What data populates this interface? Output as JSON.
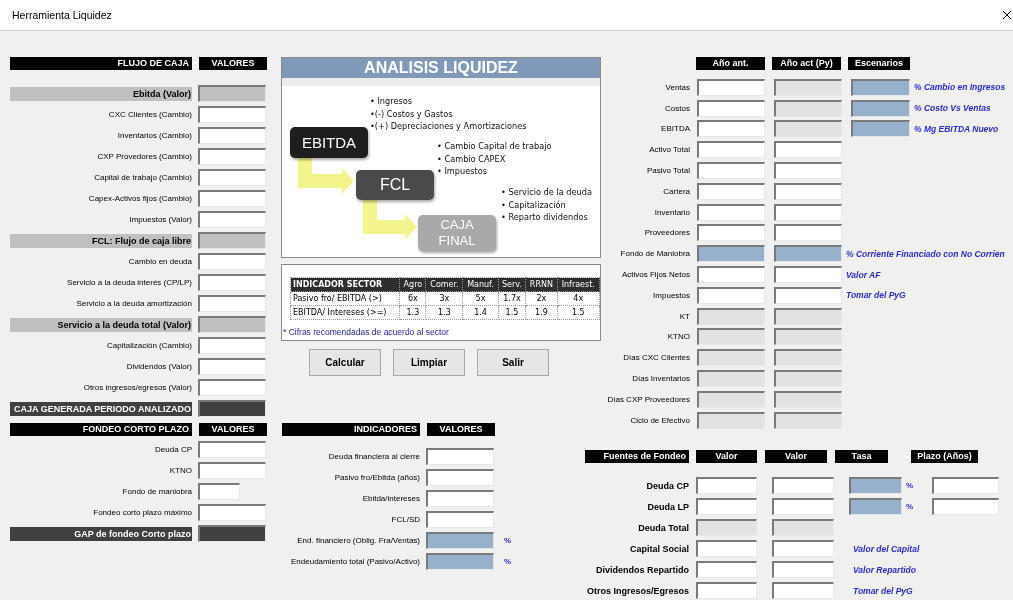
{
  "window": {
    "title": "Herramienta Liquidez"
  },
  "cash_flow": {
    "header": "FLUJO DE CAJA",
    "value_header": "VALORES",
    "rows": [
      {
        "label": "Ebitda (Valor)",
        "kind": "subtotal",
        "field": {
          "kind": "mid"
        }
      },
      {
        "label": "CXC Clientes (Cambio)",
        "kind": "item",
        "field": {
          "kind": "white"
        }
      },
      {
        "label": "Inventarios (Cambio)",
        "kind": "item",
        "field": {
          "kind": "white"
        }
      },
      {
        "label": "CXP Provedores (Cambio)",
        "kind": "item",
        "field": {
          "kind": "white"
        }
      },
      {
        "label": "Capital de trabajo (Cambio)",
        "kind": "item",
        "field": {
          "kind": "white"
        }
      },
      {
        "label": "Capex-Activos fijos (Cambio)",
        "kind": "item",
        "field": {
          "kind": "white"
        }
      },
      {
        "label": "Impuestos (Valor)",
        "kind": "item",
        "field": {
          "kind": "white"
        }
      },
      {
        "label": "FCL: Flujo de caja libre",
        "kind": "subtotal",
        "field": {
          "kind": "mid"
        }
      },
      {
        "label": "Cambio en deuda",
        "kind": "item",
        "field": {
          "kind": "white"
        }
      },
      {
        "label": "Servicio a la deuda interés (CP/LP)",
        "kind": "item",
        "field": {
          "kind": "white"
        }
      },
      {
        "label": "Servicio a la deuda amortización",
        "kind": "item",
        "field": {
          "kind": "white"
        }
      },
      {
        "label": "Servicio a la deuda total (Valor)",
        "kind": "subtotal",
        "field": {
          "kind": "mid"
        }
      },
      {
        "label": "Capitalización (Cambio)",
        "kind": "item",
        "field": {
          "kind": "white"
        }
      },
      {
        "label": "Dividendos (Valor)",
        "kind": "item",
        "field": {
          "kind": "white"
        }
      },
      {
        "label": "Otros ingresos/egresos (Valor)",
        "kind": "item",
        "field": {
          "kind": "white"
        }
      },
      {
        "label": "CAJA GENERADA PERIODO ANALIZADO",
        "kind": "total",
        "field": {
          "kind": "dark"
        }
      }
    ]
  },
  "diagram": {
    "title": "ANALISIS LIQUIDEZ",
    "stages": [
      {
        "label": "EBITDA",
        "kind": "first",
        "bullets": [
          "• Ingresos",
          "•(-) Costos y Gastos",
          "•(+) Depreciaciones y Amortizaciones"
        ]
      },
      {
        "label": "FCL",
        "kind": "second",
        "bullets": [
          "• Cambio Capital de trabajo",
          "• Cambio CAPEX",
          "• Impuestos"
        ]
      },
      {
        "label": "CAJA FINAL",
        "kind": "third",
        "bullets": [
          "• Servicio de la deuda",
          "• Capitalización",
          "• Reparto dividendos"
        ]
      }
    ]
  },
  "sector_table": {
    "columns": [
      "INDICADOR SECTOR",
      "Agro",
      "Comer.",
      "Manuf.",
      "Serv.",
      "RRNN",
      "Infraest."
    ],
    "rows": [
      [
        "Pasivo fro/ EBITDA (>)",
        "6x",
        "3x",
        "5x",
        "1.7x",
        "2x",
        "4x"
      ],
      [
        "EBITDA/ Intereses (>=)",
        "1.3",
        "1.3",
        "1.4",
        "1.5",
        "1.9",
        "1.5"
      ]
    ],
    "footnote": "* Cifras recomendadas de acuerdo al sector"
  },
  "buttons": [
    "Calcular",
    "Limpiar",
    "Salir"
  ],
  "scenario": {
    "headers": [
      "Año ant.",
      "Año act (Py)",
      "Escenarios"
    ],
    "rows": [
      {
        "label": "Ventas",
        "fields": [
          {
            "kind": "white"
          },
          {
            "kind": "gray"
          },
          {
            "kind": "blue"
          }
        ],
        "note": "% Cambio en Ingresos"
      },
      {
        "label": "Costos",
        "fields": [
          {
            "kind": "white"
          },
          {
            "kind": "gray"
          },
          {
            "kind": "blue"
          }
        ],
        "note": "% Costo Vs Ventas"
      },
      {
        "label": "EBITDA",
        "fields": [
          {
            "kind": "white"
          },
          {
            "kind": "gray"
          },
          {
            "kind": "blue"
          }
        ],
        "note": "% Mg EBITDA Nuevo"
      },
      {
        "label": "Activo Total",
        "fields": [
          {
            "kind": "white"
          },
          {
            "kind": "white"
          }
        ]
      },
      {
        "label": "Pasivo Total",
        "fields": [
          {
            "kind": "white"
          },
          {
            "kind": "white"
          }
        ]
      },
      {
        "label": "Cartera",
        "fields": [
          {
            "kind": "white"
          },
          {
            "kind": "white"
          }
        ]
      },
      {
        "label": "Inventario",
        "fields": [
          {
            "kind": "white"
          },
          {
            "kind": "white"
          }
        ]
      },
      {
        "label": "Proveedores",
        "fields": [
          {
            "kind": "white"
          },
          {
            "kind": "white"
          }
        ]
      },
      {
        "label": "Fondo de Maniobra",
        "fields": [
          {
            "kind": "blue"
          },
          {
            "kind": "blue"
          }
        ],
        "note": "% Corriente Financiado con No Corrien"
      },
      {
        "label": "Activos Fijos Netos",
        "fields": [
          {
            "kind": "white"
          },
          {
            "kind": "white"
          }
        ],
        "note": "Valor AF"
      },
      {
        "label": "Impuestos",
        "fields": [
          {
            "kind": "white"
          },
          {
            "kind": "white"
          }
        ],
        "note": "Tomar del PyG"
      },
      {
        "label": "KT",
        "fields": [
          {
            "kind": "gray"
          },
          {
            "kind": "gray"
          }
        ]
      },
      {
        "label": "KTNO",
        "fields": [
          {
            "kind": "gray"
          },
          {
            "kind": "gray"
          }
        ]
      },
      {
        "label": "Días CXC Clientes",
        "fields": [
          {
            "kind": "gray"
          },
          {
            "kind": "gray"
          }
        ]
      },
      {
        "label": "Días Inventarios",
        "fields": [
          {
            "kind": "gray"
          },
          {
            "kind": "gray"
          }
        ]
      },
      {
        "label": "Días CXP Proveedores",
        "fields": [
          {
            "kind": "gray"
          },
          {
            "kind": "gray"
          }
        ]
      },
      {
        "label": "Ciclo de Efectivo",
        "fields": [
          {
            "kind": "gray"
          },
          {
            "kind": "gray"
          }
        ]
      }
    ]
  },
  "short_term_funding": {
    "header": "FONDEO CORTO PLAZO",
    "value_header": "VALORES",
    "rows": [
      {
        "label": "Deuda CP",
        "kind": "item",
        "field": {
          "kind": "white"
        }
      },
      {
        "label": "KTNO",
        "kind": "item",
        "field": {
          "kind": "white"
        }
      },
      {
        "label": "Fondo de maniobra",
        "kind": "item",
        "field": {
          "kind": "short"
        }
      },
      {
        "label": "Fondeo corto plazo máximo",
        "kind": "item",
        "field": {
          "kind": "white"
        }
      },
      {
        "label": "GAP de fondeo Corto plazo",
        "kind": "total",
        "field": {
          "kind": "dark"
        }
      }
    ]
  },
  "indicators": {
    "header": "INDICADORES",
    "value_header": "VALORES",
    "rows": [
      {
        "label": "Deuda financiera al cierre",
        "field": {
          "kind": "white"
        }
      },
      {
        "label": "Pasivo fro/Ebitda (años)",
        "field": {
          "kind": "white"
        }
      },
      {
        "label": "Ebitda/intereses",
        "field": {
          "kind": "white"
        }
      },
      {
        "label": "FCL/SD",
        "field": {
          "kind": "white"
        }
      },
      {
        "label": "End. financiero (Oblig. Fra/Ventas)",
        "field": {
          "kind": "blue"
        },
        "suffix": "%"
      },
      {
        "label": "Endeudamiento total (Pasivo/Activo)",
        "field": {
          "kind": "blue"
        },
        "suffix": "%"
      }
    ]
  },
  "funding_sources": {
    "headers": [
      "Fuentes de Fondeo",
      "Valor",
      "Valor",
      "Tasa",
      "Plazo (Años)"
    ],
    "rows": [
      {
        "label": "Deuda CP",
        "cells": [
          {
            "kind": "white"
          },
          {
            "kind": "white"
          },
          {
            "kind": "blue",
            "suffix": "%"
          },
          {
            "kind": "white"
          }
        ]
      },
      {
        "label": "Deuda LP",
        "cells": [
          {
            "kind": "white"
          },
          {
            "kind": "white"
          },
          {
            "kind": "blue",
            "suffix": "%"
          },
          {
            "kind": "white"
          }
        ]
      },
      {
        "label": "Deuda Total",
        "cells": [
          {
            "kind": "gray"
          },
          {
            "kind": "gray"
          }
        ]
      },
      {
        "label": "Capital Social",
        "cells": [
          {
            "kind": "white"
          },
          {
            "kind": "white"
          }
        ],
        "note": "Valor del Capital"
      },
      {
        "label": "Dividendos Repartido",
        "cells": [
          {
            "kind": "white"
          },
          {
            "kind": "white"
          }
        ],
        "note": "Valor Repartido"
      },
      {
        "label": "Otros Ingresos/Egresos",
        "cells": [
          {
            "kind": "white"
          },
          {
            "kind": "white"
          }
        ],
        "note": "Tomar del PyG"
      }
    ]
  }
}
